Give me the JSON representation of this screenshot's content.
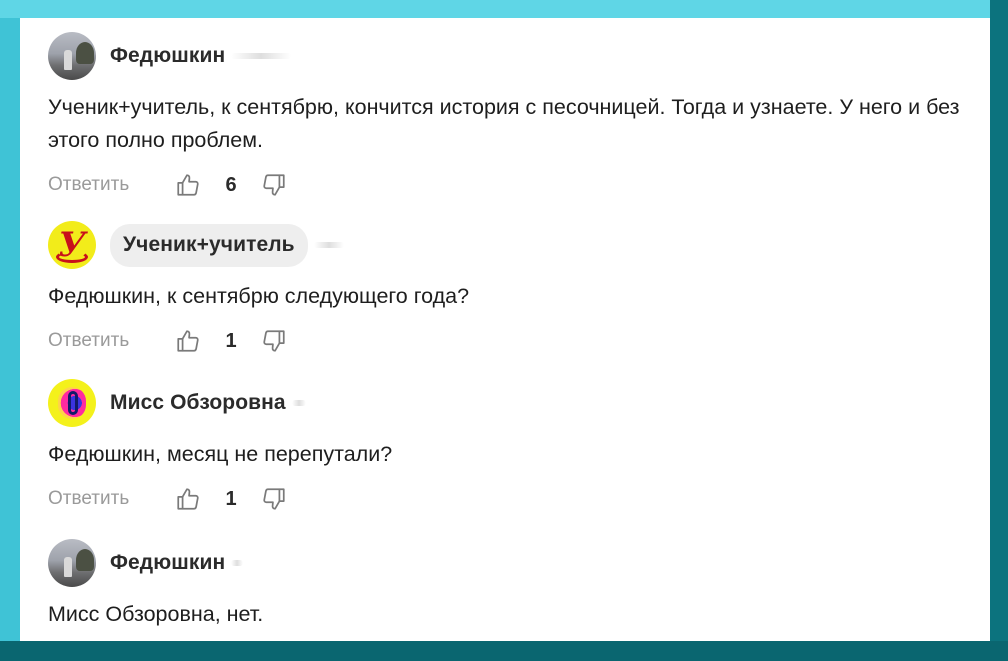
{
  "comments": [
    {
      "author": "Федюшкин",
      "avatar_icon": "photo-avatar",
      "text": "Ученик+учитель, к сентябрю, кончится история с песочницей. Тогда и узнаете. У него и без этого полно проблем.",
      "reply_label": "Ответить",
      "likes": "6"
    },
    {
      "author": "Ученик+учитель",
      "avatar_icon": "letter-u-avatar",
      "avatar_glyph": "У",
      "text": "Федюшкин, к сентябрю следующего года?",
      "reply_label": "Ответить",
      "likes": "1"
    },
    {
      "author": "Мисс Обзоровна",
      "avatar_icon": "colorful-avatar",
      "text": "Федюшкин, месяц не перепутали?",
      "reply_label": "Ответить",
      "likes": "1"
    },
    {
      "author": "Федюшкин",
      "avatar_icon": "photo-avatar",
      "text": "Мисс Обзоровна, нет."
    }
  ],
  "colors": {
    "frame": "#0e7f8a",
    "accent_yellow": "#f2ec1a",
    "reply_gray": "#9a9a9a"
  }
}
